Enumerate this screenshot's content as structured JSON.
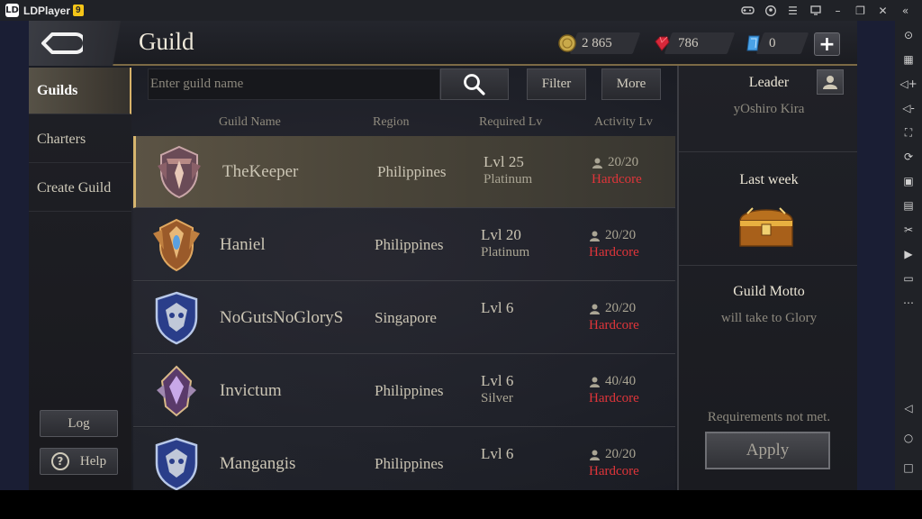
{
  "window": {
    "app_name": "LDPlayer",
    "version_badge": "9",
    "title_icons": [
      "gamepad-icon",
      "account-icon",
      "menu-icon",
      "screen-icon",
      "minimize-icon",
      "restore-icon",
      "close-icon",
      "collapse-icon"
    ]
  },
  "toolbar": {
    "icons": [
      "target-icon",
      "keyboard-icon",
      "volume-up-icon",
      "volume-down-icon",
      "fullscreen-icon",
      "rotate-icon",
      "screenshot-icon",
      "apk-icon",
      "scissors-icon",
      "video-icon",
      "notes-icon",
      "more-icon"
    ],
    "nav_icons": [
      "back-nav-icon",
      "home-nav-icon",
      "recent-nav-icon"
    ]
  },
  "header": {
    "title": "Guild",
    "currencies": [
      {
        "name": "gold",
        "value": "2 865",
        "color": "#c9a94a"
      },
      {
        "name": "diamond",
        "value": "786",
        "color": "#d8283a"
      },
      {
        "name": "voucher",
        "value": "0",
        "color": "#4aa3e8"
      }
    ],
    "add_symbol": "+"
  },
  "nav": {
    "items": [
      {
        "label": "Guilds",
        "active": true
      },
      {
        "label": "Charters",
        "active": false
      },
      {
        "label": "Create Guild",
        "active": false
      }
    ],
    "log_label": "Log",
    "help_label": "Help",
    "help_symbol": "?"
  },
  "search": {
    "placeholder": "Enter guild name",
    "value": "",
    "filter_label": "Filter",
    "more_label": "More"
  },
  "columns": {
    "name": "Guild Name",
    "region": "Region",
    "required": "Required Lv",
    "activity": "Activity Lv"
  },
  "guilds": [
    {
      "name": "TheKeeper",
      "region": "Philippines",
      "level": "Lvl 25",
      "tier": "Platinum",
      "members": "20/20",
      "activity": "Hardcore",
      "emblem": "bronze-shield-emblem",
      "selected": true
    },
    {
      "name": "Haniel",
      "region": "Philippines",
      "level": "Lvl 20",
      "tier": "Platinum",
      "members": "20/20",
      "activity": "Hardcore",
      "emblem": "gold-wing-emblem",
      "selected": false
    },
    {
      "name": "NoGutsNoGloryS",
      "region": "Singapore",
      "level": "Lvl 6",
      "tier": "",
      "members": "20/20",
      "activity": "Hardcore",
      "emblem": "blue-owl-emblem",
      "selected": false
    },
    {
      "name": "Invictum",
      "region": "Philippines",
      "level": "Lvl 6",
      "tier": "Silver",
      "members": "40/40",
      "activity": "Hardcore",
      "emblem": "purple-crest-emblem",
      "selected": false
    },
    {
      "name": "Mangangis",
      "region": "Philippines",
      "level": "Lvl 6",
      "tier": "",
      "members": "20/20",
      "activity": "Hardcore",
      "emblem": "blue-owl-emblem",
      "selected": false
    }
  ],
  "detail": {
    "leader_label": "Leader",
    "leader_name": "yOshiro Kira",
    "last_week_label": "Last week",
    "motto_label": "Guild Motto",
    "motto": "will take to Glory",
    "requirement_note": "Requirements not met.",
    "apply_label": "Apply"
  }
}
